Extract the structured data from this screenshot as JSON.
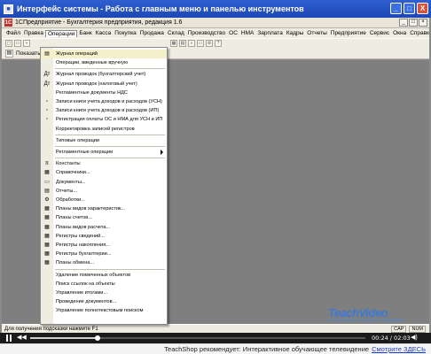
{
  "window": {
    "title": "Интерфейс системы - Работа с главным меню и панелью инструментов",
    "buttons": [
      "_",
      "□",
      "X"
    ]
  },
  "app": {
    "title": "1СПредприятие - Бухгалтерия предприятия, редакция 1.6",
    "logo": "1С"
  },
  "menubar": {
    "items": [
      "Файл",
      "Правка",
      "Операции",
      "Банк",
      "Касса",
      "Покупка",
      "Продажа",
      "Склад",
      "Производство",
      "ОС",
      "НМА",
      "Зарплата",
      "Кадры",
      "Отчеты",
      "Предприятие",
      "Сервис",
      "Окна",
      "Справка"
    ],
    "active_index": 2
  },
  "toolbar2": {
    "label": "Показать па"
  },
  "dropdown": {
    "items": [
      {
        "label": "Журнал операций",
        "icon": "journal-icon",
        "glyph": "▤",
        "highlighted": true
      },
      {
        "label": "Операции, введенные вручную",
        "icon": "",
        "glyph": ""
      },
      {
        "sep": true
      },
      {
        "label": "Журнал проводок (бухгалтерский учет)",
        "icon": "",
        "glyph": "Дт"
      },
      {
        "label": "Журнал проводок (налоговый учет)",
        "icon": "",
        "glyph": "Дт"
      },
      {
        "label": "Регламентные документы НДС",
        "icon": "",
        "glyph": ""
      },
      {
        "label": "Записи книги учета доходов и расходов (УСН)",
        "icon": "",
        "glyph": "▫"
      },
      {
        "label": "Записи книги учета доходов и расходов (ИП)",
        "icon": "",
        "glyph": "▫"
      },
      {
        "label": "Регистрация оплаты ОС и НМА для УСН и ИП",
        "icon": "",
        "glyph": "▫"
      },
      {
        "label": "Корректировка записей регистров",
        "icon": "",
        "glyph": ""
      },
      {
        "sep": true
      },
      {
        "label": "Типовые операции",
        "icon": "",
        "glyph": ""
      },
      {
        "sep": true
      },
      {
        "label": "Регламентные операции",
        "icon": "",
        "glyph": "",
        "submenu": true
      },
      {
        "sep": true
      },
      {
        "label": "Константы",
        "icon": "",
        "glyph": "π"
      },
      {
        "label": "Справочники...",
        "icon": "",
        "glyph": "▦"
      },
      {
        "label": "Документы...",
        "icon": "",
        "glyph": "▭"
      },
      {
        "label": "Отчеты...",
        "icon": "",
        "glyph": "▤"
      },
      {
        "label": "Обработки...",
        "icon": "",
        "glyph": "⚙"
      },
      {
        "label": "Планы видов характеристик...",
        "icon": "",
        "glyph": "▦"
      },
      {
        "label": "Планы счетов...",
        "icon": "",
        "glyph": "▦"
      },
      {
        "label": "Планы видов расчета...",
        "icon": "",
        "glyph": "▦"
      },
      {
        "label": "Регистры сведений...",
        "icon": "",
        "glyph": "▦"
      },
      {
        "label": "Регистры накопления...",
        "icon": "",
        "glyph": "▦"
      },
      {
        "label": "Регистры бухгалтерии...",
        "icon": "",
        "glyph": "▦"
      },
      {
        "label": "Планы обмена...",
        "icon": "",
        "glyph": "▦"
      },
      {
        "sep": true
      },
      {
        "label": "Удаление помеченных объектов",
        "icon": "",
        "glyph": ""
      },
      {
        "label": "Поиск ссылок на объекты",
        "icon": "",
        "glyph": ""
      },
      {
        "label": "Управление итогами...",
        "icon": "",
        "glyph": ""
      },
      {
        "label": "Проведение документов...",
        "icon": "",
        "glyph": ""
      },
      {
        "label": "Управление полнотекстовым поиском",
        "icon": "",
        "glyph": ""
      }
    ]
  },
  "status": {
    "hint": "Для получения подсказки нажмите F1",
    "indicators": [
      "CAP",
      "NUM"
    ]
  },
  "watermark": {
    "brand": "TeachVideo",
    "tagline": "Интерактивное обучающее телевидение"
  },
  "player": {
    "time": "00:24 / 02:03",
    "progress": 0.2
  },
  "promo": {
    "text": "TeachShop рекомендует: Интерактивное обучающее телевидение",
    "link": "Смотрите ЗДЕСЬ"
  },
  "colors": {
    "title_bar": "#1d48b4",
    "workspace": "#7f7f7f",
    "menu_highlight": "#f5f0cc",
    "link": "#1a3fd0"
  }
}
